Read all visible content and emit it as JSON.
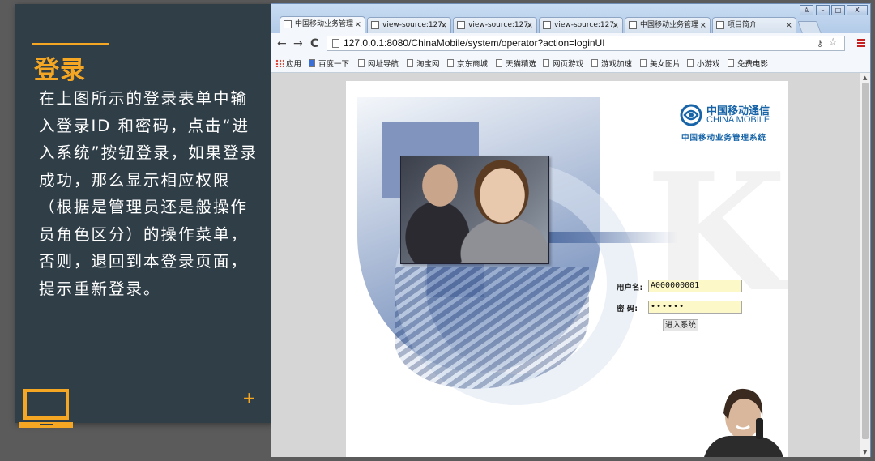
{
  "slide": {
    "heading": "登录",
    "description": "在上图所示的登录表单中输入登录ID 和密码，点击“进入系统”按钮登录，如果登录成功，那么显示相应权限（根据是管理员还是般操作员角色区分）的操作菜单，否则，退回到本登录页面，提示重新登录。",
    "plus_symbol": "+",
    "icon_left": "laptop-icon",
    "accent_color": "#f5a623",
    "panel_color": "#2f3e47"
  },
  "browser": {
    "tabs": [
      {
        "label": "中国移动业务管理",
        "active": true
      },
      {
        "label": "view-source:127.",
        "active": false
      },
      {
        "label": "view-source:127.",
        "active": false
      },
      {
        "label": "view-source:127.",
        "active": false
      },
      {
        "label": "中国移动业务管理",
        "active": false
      },
      {
        "label": "项目简介",
        "active": false
      }
    ],
    "window_buttons": [
      "♙",
      "–",
      "□",
      "X"
    ],
    "url": "127.0.0.1:8080/ChinaMobile/system/operator?action=loginUI",
    "bookmarks": [
      "应用",
      "百度一下",
      "网址导航",
      "淘宝网",
      "京东商城",
      "天猫精选",
      "网页游戏",
      "游戏加速",
      "美女图片",
      "小游戏",
      "免费电影"
    ]
  },
  "login_page": {
    "logo_cn": "中国移动通信",
    "logo_en": "CHINA MOBILE",
    "logo_sub": "中国移动业务管理系统",
    "username_label": "用户名:",
    "username_value": "A000000001",
    "password_label": "密  码:",
    "password_value": "••••••",
    "submit_label": "进入系统"
  }
}
